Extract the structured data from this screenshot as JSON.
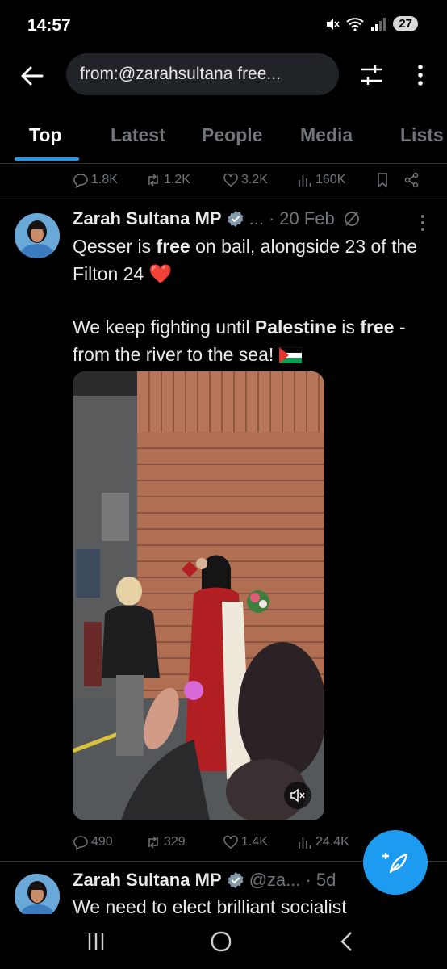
{
  "status_bar": {
    "time": "14:57",
    "battery": "27"
  },
  "search": {
    "query": "from:@zarahsultana free..."
  },
  "tabs": [
    {
      "label": "Top"
    },
    {
      "label": "Latest"
    },
    {
      "label": "People"
    },
    {
      "label": "Media"
    },
    {
      "label": "Lists"
    }
  ],
  "prev_tweet": {
    "replies": "1.8K",
    "reposts": "1.2K",
    "likes": "3.2K",
    "views": "160K"
  },
  "tweet1": {
    "name": "Zarah Sultana MP",
    "handle": "...",
    "date": "20 Feb",
    "line1_a": "Qesser is ",
    "line1_b": "free",
    "line1_c": " on bail, alongside 23 of the Filton 24 ",
    "heart": "❤️",
    "line2_a": "We keep fighting until ",
    "line2_b": "Palestine",
    "line2_c": " is ",
    "line2_d": "free",
    "line2_e": " - from the river to the sea! ",
    "replies": "490",
    "reposts": "329",
    "likes": "1.4K",
    "views": "24.4K"
  },
  "tweet2": {
    "name": "Zarah Sultana MP",
    "handle": "@za...",
    "date": "5d",
    "text": "We need to elect brilliant socialist"
  },
  "colors": {
    "accent": "#1d9bf0",
    "background": "#000000",
    "muted": "#71767b"
  }
}
